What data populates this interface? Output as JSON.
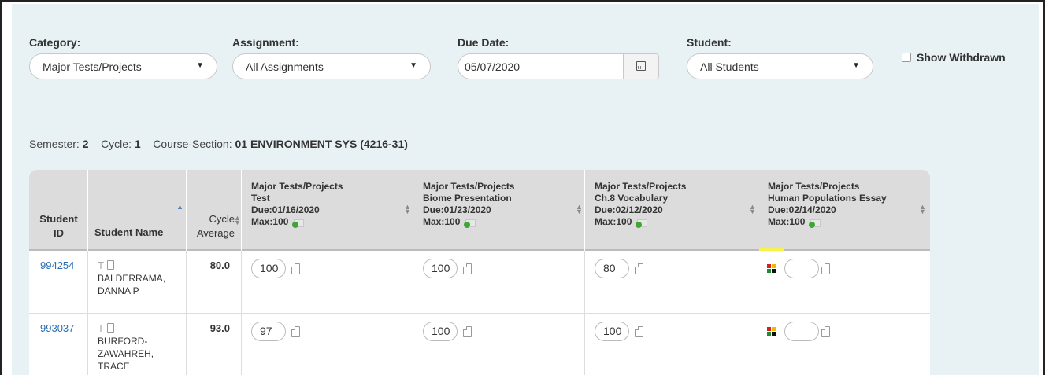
{
  "filters": {
    "category": {
      "label": "Category:",
      "value": "Major Tests/Projects"
    },
    "assignment": {
      "label": "Assignment:",
      "value": "All Assignments"
    },
    "due_date": {
      "label": "Due Date:",
      "value": "05/07/2020"
    },
    "student": {
      "label": "Student:",
      "value": "All Students"
    },
    "show_withdrawn": {
      "label": "Show Withdrawn",
      "checked": false
    }
  },
  "course_info": {
    "semester_label": "Semester:",
    "semester": "2",
    "cycle_label": "Cycle:",
    "cycle": "1",
    "course_label": "Course-Section:",
    "course": "01 ENVIRONMENT SYS (4216-31)"
  },
  "table": {
    "headers": {
      "student_id": [
        "Student",
        "ID"
      ],
      "student_name": "Student Name",
      "cycle_average": [
        "Cycle",
        "Average"
      ]
    },
    "assignments": [
      {
        "category": "Major Tests/Projects",
        "name": "Test",
        "due": "Due:01/16/2020",
        "max": "Max:100"
      },
      {
        "category": "Major Tests/Projects",
        "name": "Biome Presentation",
        "due": "Due:01/23/2020",
        "max": "Max:100"
      },
      {
        "category": "Major Tests/Projects",
        "name": "Ch.8 Vocabulary",
        "due": "Due:02/12/2020",
        "max": "Max:100"
      },
      {
        "category": "Major Tests/Projects",
        "name": "Human Populations Essay",
        "due": "Due:02/14/2020",
        "max": "Max:100"
      }
    ],
    "rows": [
      {
        "id": "994254",
        "name_line1": "BALDERRAMA,",
        "name_line2": "DANNA P",
        "name_line3": "",
        "average": "80.0",
        "scores": [
          "100",
          "100",
          "80",
          ""
        ]
      },
      {
        "id": "993037",
        "name_line1": "BURFORD-",
        "name_line2": "ZAWAHREH,",
        "name_line3": "TRACE",
        "average": "93.0",
        "scores": [
          "97",
          "100",
          "100",
          ""
        ]
      }
    ]
  },
  "colors": {
    "panel_bg": "#e8f1f4",
    "header_bg": "#dcdcdc",
    "link": "#2a6fb5",
    "highlight": "#f8f24f"
  },
  "icons": [
    "calendar-icon",
    "checkbox",
    "sort-arrows-icon",
    "add-assignment-icon",
    "note-icon",
    "color-status-icon"
  ]
}
